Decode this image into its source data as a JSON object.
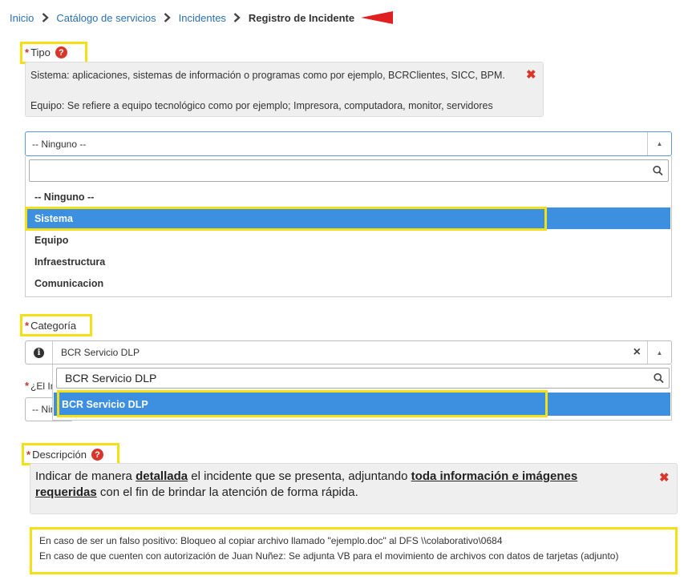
{
  "breadcrumb": {
    "home": "Inicio",
    "catalog": "Catálogo de servicios",
    "incidents": "Incidentes",
    "current": "Registro de Incidente"
  },
  "tipo": {
    "required_mark": "*",
    "label": "Tipo",
    "help_icon": "?",
    "info_line1": "Sistema: aplicaciones, sistemas de información o programas como por ejemplo, BCRClientes, SICC, BPM.",
    "info_line2": "Equipo: Se refiere a equipo tecnológico como por ejemplo; Impresora, computadora, monitor, servidores",
    "selected_value": "-- Ninguno --",
    "search_value": "",
    "options": [
      "-- Ninguno --",
      "Sistema",
      "Equipo",
      "Infraestructura",
      "Comunicacion"
    ],
    "highlighted_option": "Sistema"
  },
  "categoria": {
    "required_mark": "*",
    "label": "Categoría",
    "selected_value": "BCR Servicio DLP",
    "clear": "×",
    "search_value": "BCR Servicio DLP",
    "options": [
      "BCR Servicio DLP"
    ]
  },
  "hidden_field": {
    "required_mark": "*",
    "label_partial": "¿El In",
    "value_partial": "-- Nin"
  },
  "descripcion": {
    "required_mark": "*",
    "label": "Descripción",
    "help_icon": "?",
    "instructions": {
      "t1": "Indicar de manera ",
      "b1": "detallada",
      "t2": " el incidente que se presenta, adjuntando ",
      "b2": "toda información e imágenes",
      "b3": "requeridas",
      "t3": " con el fin de brindar la atención de forma rápida."
    },
    "example_line1": "En caso de ser un falso positivo: Bloqueo al copiar archivo llamado \"ejemplo.doc\" al DFS \\\\colaborativo\\0684",
    "example_line2": "En caso de que cuenten con autorización de Juan Nuñez: Se adjunta VB para el movimiento de archivos con datos de tarjetas (adjunto)"
  },
  "colors": {
    "highlight": "#f5e017",
    "selected_option": "#3d8fe0",
    "link": "#2a6fb0",
    "close": "#d9362b",
    "arrow": "#e02020"
  },
  "icons": {
    "breadcrumb_separator": "chevron-right-icon",
    "pointer": "red-arrow-icon",
    "close": "close-icon",
    "search": "search-icon",
    "dropdown": "caret-up-icon",
    "info": "info-icon",
    "help": "question-circle-icon"
  }
}
